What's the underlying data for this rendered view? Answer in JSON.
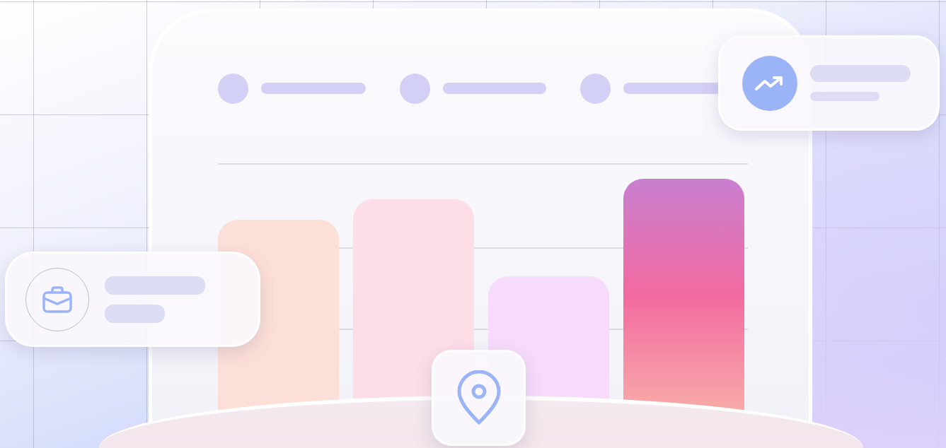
{
  "legend": {
    "items": [
      {
        "kind": "entry"
      },
      {
        "kind": "entry"
      },
      {
        "kind": "entry"
      }
    ]
  },
  "chart": {
    "bars": [
      {
        "color": "#fcdfd6"
      },
      {
        "color": "#fddde6"
      },
      {
        "color": "#f6dcfa"
      },
      {
        "color": "#f26aa0"
      }
    ]
  },
  "floating_cards": [
    {
      "kind": "trend"
    },
    {
      "kind": "briefcase"
    },
    {
      "kind": "location"
    }
  ]
}
